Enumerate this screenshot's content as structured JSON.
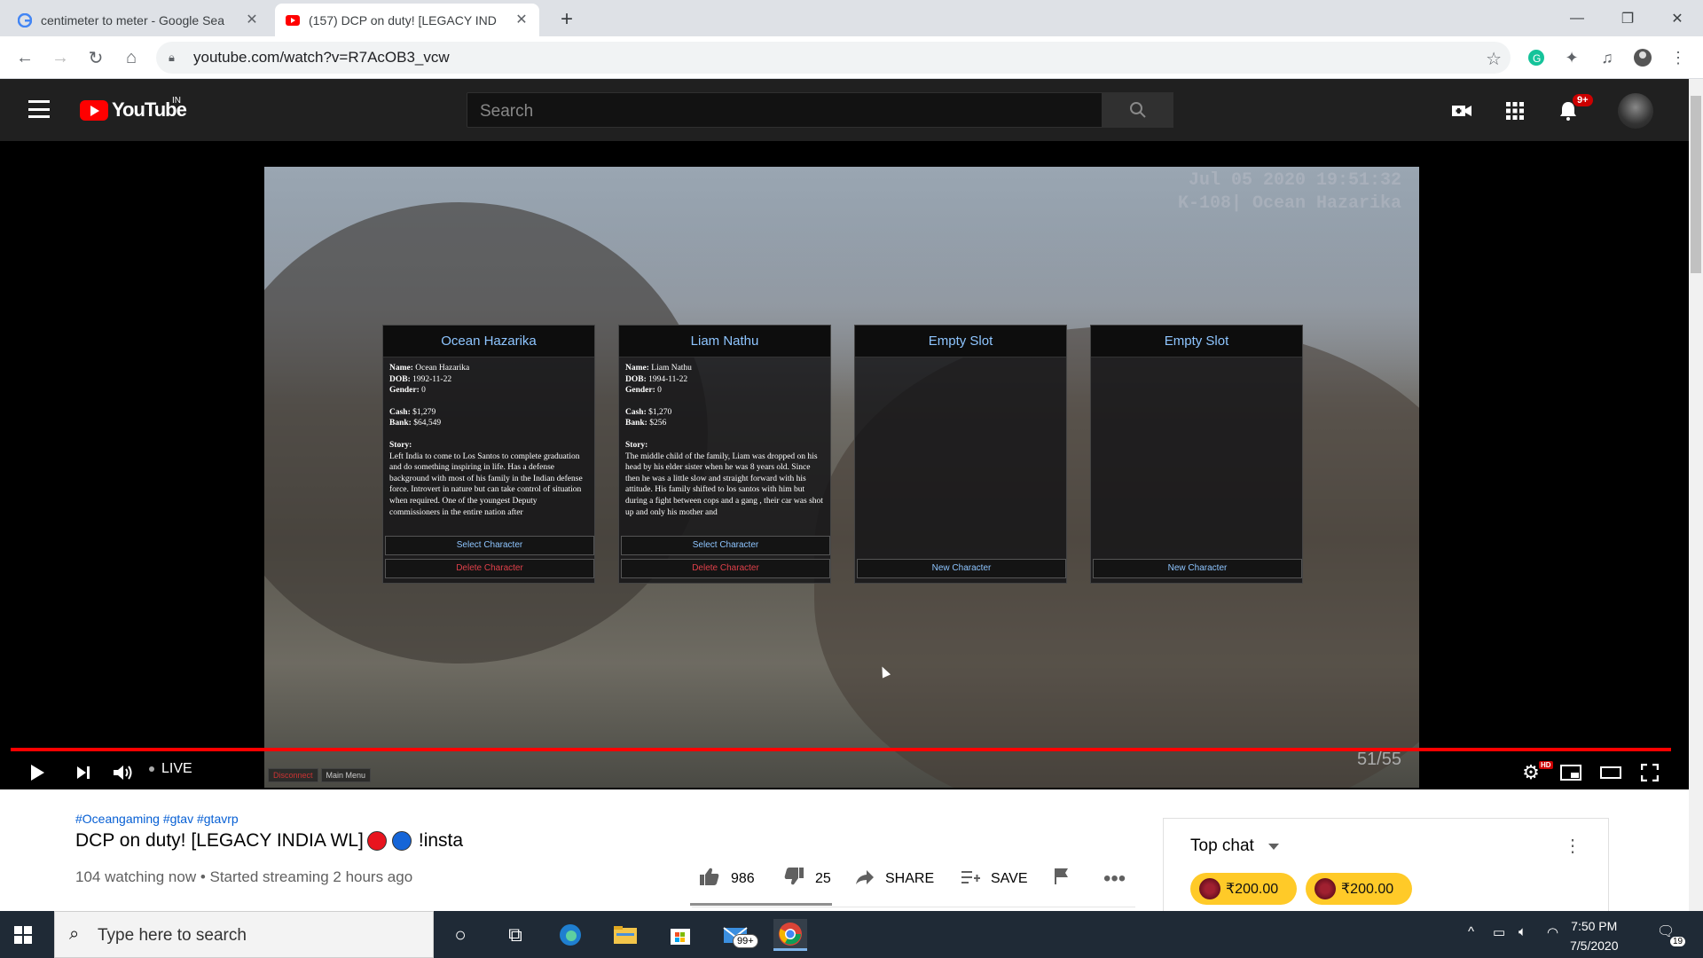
{
  "browser": {
    "tabs": [
      {
        "title": "centimeter to meter - Google Sea",
        "icon": "google-icon",
        "active": false
      },
      {
        "title": "(157) DCP on duty! [LEGACY IND",
        "icon": "youtube-icon",
        "active": true
      }
    ],
    "url": "youtube.com/watch?v=R7AcOB3_vcw"
  },
  "youtube": {
    "country": "IN",
    "logo_word": "YouTube",
    "search_placeholder": "Search",
    "notification_count": "9+"
  },
  "game": {
    "clock": "Jul 05 2020 19:51:32",
    "clock_sub": "K-108| Ocean Hazarika",
    "characters": [
      {
        "title": "Ocean Hazarika",
        "name": "Ocean Hazarika",
        "dob": "1992-11-22",
        "gender": "0",
        "cash": "$1,279",
        "bank": "$64,549",
        "story": "Left India to come to Los Santos to complete graduation and do something inspiring in life. Has a defense background with most of his family in the Indian defense force. Introvert in nature but can take control of situation when required. One of the youngest Deputy commissioners in the entire nation after",
        "select_label": "Select Character",
        "delete_label": "Delete Character"
      },
      {
        "title": "Liam Nathu",
        "name": "Liam Nathu",
        "dob": "1994-11-22",
        "gender": "0",
        "cash": "$1,270",
        "bank": "$256",
        "story": "The middle child of the family, Liam was dropped on his head by his elder sister when he was 8 years old. Since then he was a little slow and straight forward with his attitude. His family shifted to los santos with him but during a fight between cops and a gang , their car was shot up and only his mother and",
        "select_label": "Select Character",
        "delete_label": "Delete Character"
      }
    ],
    "empty_slots": [
      {
        "title": "Empty Slot",
        "new_label": "New Character"
      },
      {
        "title": "Empty Slot",
        "new_label": "New Character"
      }
    ],
    "labels": {
      "name": "Name:",
      "dob": "DOB:",
      "gender": "Gender:",
      "cash": "Cash:",
      "bank": "Bank:",
      "story": "Story:"
    },
    "bottom_tabs": [
      "Disconnect",
      "Main Menu"
    ],
    "counter": "51/55"
  },
  "player": {
    "live_label": "LIVE",
    "progress_fraction": 1.0
  },
  "video": {
    "hashtags": "#Oceangaming #gtav #gtavrp",
    "title": "DCP on duty! [LEGACY INDIA WL]",
    "title_suffix": "!insta",
    "meta": "104 watching now • Started streaming 2 hours ago",
    "likes": "986",
    "dislikes": "25",
    "share_label": "SHARE",
    "save_label": "SAVE"
  },
  "chat": {
    "title": "Top chat",
    "superchats": [
      "₹200.00",
      "₹200.00"
    ]
  },
  "taskbar": {
    "search_placeholder": "Type here to search",
    "mail_badge": "99+",
    "time": "7:50 PM",
    "date": "7/5/2020",
    "notification_count": "19"
  }
}
